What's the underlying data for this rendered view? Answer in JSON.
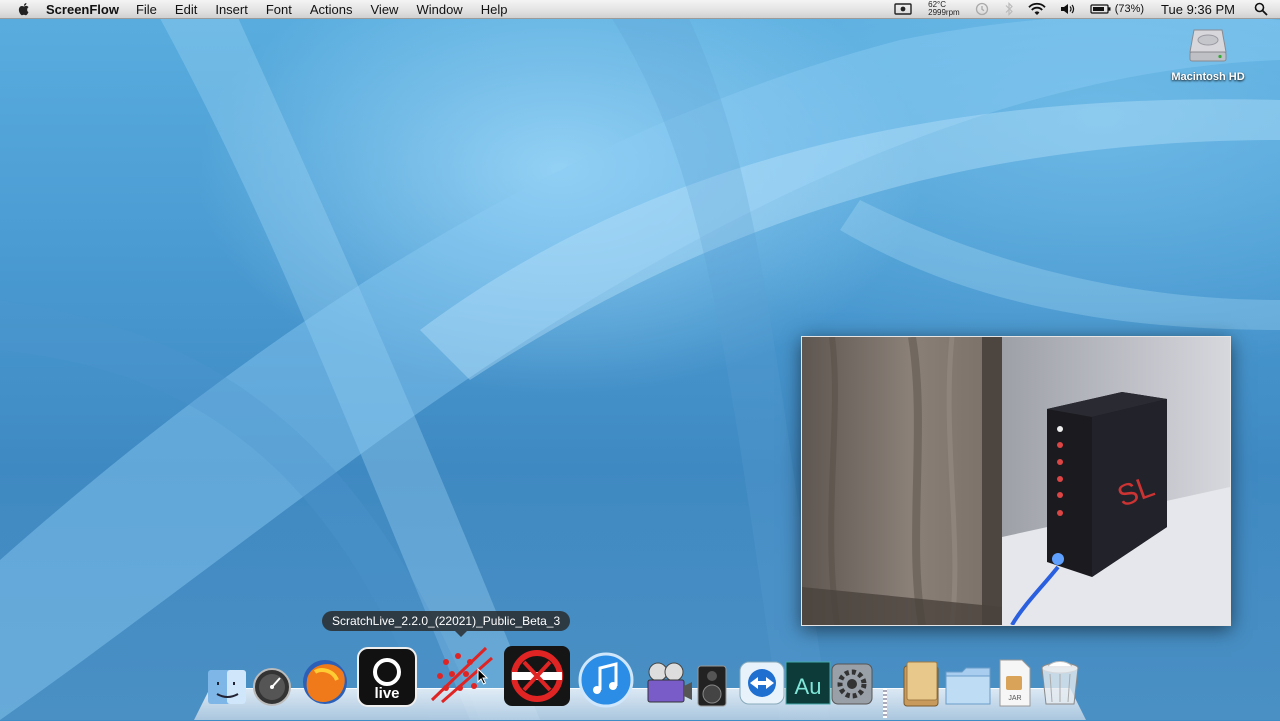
{
  "menubar": {
    "app_name": "ScreenFlow",
    "menus": [
      "File",
      "Edit",
      "Insert",
      "Font",
      "Actions",
      "View",
      "Window",
      "Help"
    ],
    "status": {
      "temperature": "62°C",
      "fan_speed": "2999rpm",
      "battery_percent": "(73%)",
      "clock": "Tue 9:36 PM"
    }
  },
  "desktop": {
    "hd_label": "Macintosh HD"
  },
  "tooltip": "ScratchLive_2.2.0_(22021)_Public_Beta_3",
  "dock": {
    "live_label": "live",
    "au_label": "Au",
    "jar_label": "JAR",
    "items": [
      "finder-icon",
      "dashboard-icon",
      "firefox-icon",
      "ableton-live-icon",
      "scratchlive-beta-icon",
      "serato-scratchlive-icon",
      "itunes-icon",
      "imovie-icon",
      "speaker-icon",
      "teamviewer-icon",
      "audition-icon",
      "system-preferences-icon",
      "documents-stack-icon",
      "folder-icon",
      "jar-file-icon",
      "trash-icon"
    ]
  }
}
